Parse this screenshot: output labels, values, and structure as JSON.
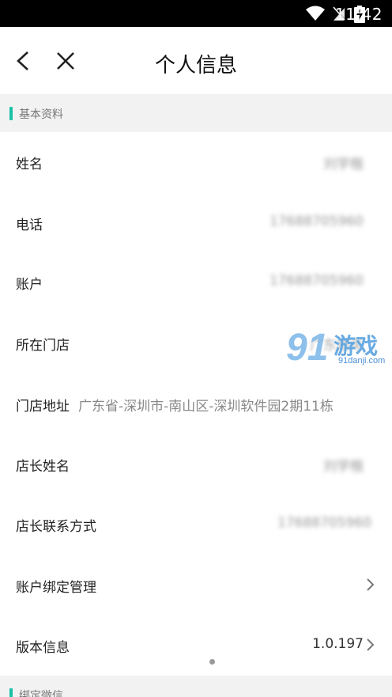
{
  "status": {
    "time": "11:42"
  },
  "header": {
    "title": "个人信息"
  },
  "sections": {
    "basic": "基本资料",
    "wechat": "绑定微信"
  },
  "rows": {
    "name": {
      "label": "姓名",
      "value": "刘学楷"
    },
    "phone": {
      "label": "电话",
      "value": "17688705960"
    },
    "account": {
      "label": "账户",
      "value": "17688705960"
    },
    "store": {
      "label": "所在门店",
      "value": "广东顺丰"
    },
    "store_address": {
      "label": "门店地址",
      "value": "广东省-深圳市-南山区-深圳软件园2期11栋"
    },
    "manager_name": {
      "label": "店长姓名",
      "value": "刘学楷"
    },
    "manager_contact": {
      "label": "店长联系方式",
      "value": "17688705960"
    },
    "account_binding": {
      "label": "账户绑定管理"
    },
    "version": {
      "label": "版本信息",
      "value": "1.0.197"
    }
  },
  "watermark": {
    "number": "91",
    "word": "游戏",
    "site": "91danji.com"
  },
  "colors": {
    "accent": "#19c1a7",
    "section_bg": "#f2f2f2"
  }
}
